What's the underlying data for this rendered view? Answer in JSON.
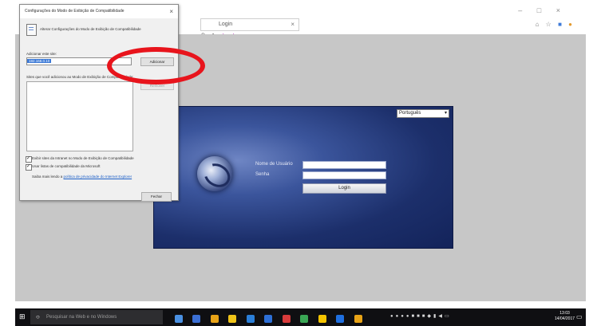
{
  "browser": {
    "tab_title": "Login",
    "tab_close": "×",
    "window_controls": [
      "–",
      "□",
      "×"
    ]
  },
  "login": {
    "language_value": "Português",
    "username_label": "Nome de Usuário",
    "username_value": "",
    "password_label": "Senha",
    "password_value": "",
    "login_button": "Login"
  },
  "dialog": {
    "title": "Configurações do Modo de Exibição de Compatibilidade",
    "close": "×",
    "header_text": "Alterar Configurações do Modo de Exibição de Compatibilidade",
    "add_site_label": "Adicionar este site:",
    "add_site_value": "192.168.0.10",
    "add_button": "Adicionar",
    "list_label": "Sites que você adicionou ao Modo de Exibição de Compatibilidade:",
    "remove_button": "Remover",
    "checkbox1_label": "Exibir sites da Intranet no Modo de Exibição de Compatibilidade",
    "checkbox1_checked": true,
    "checkbox2_label": "Usar listas de compatibilidade da Microsoft",
    "checkbox2_checked": true,
    "link_prefix": "Saiba mais lendo a",
    "link_text": "política de privacidade do Internet Explorer",
    "close_button": "Fechar"
  },
  "taskbar": {
    "search_placeholder": "Pesquisar na Web e no Windows",
    "clock_time": "13:03",
    "clock_date": "14/04/2017",
    "colors": {
      "app1": "#4a90e2",
      "app2": "#3b6fd4",
      "app3": "#e8a317",
      "app4": "#f0c419",
      "app5": "#2b7fd8",
      "app6": "#2d6fd6",
      "app7": "#d83b3b",
      "app8": "#3aa655",
      "app9": "#f5c400",
      "app10": "#1f6fe0"
    }
  },
  "annotation": {
    "circle_color": "#e8141c"
  }
}
